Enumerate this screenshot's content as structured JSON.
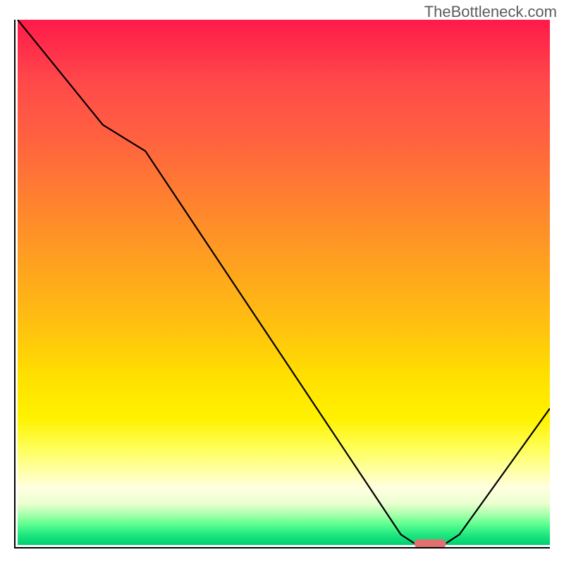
{
  "watermark": "TheBottleneck.com",
  "chart_data": {
    "type": "line",
    "title": "",
    "xlabel": "",
    "ylabel": "",
    "x_range": [
      0,
      100
    ],
    "y_range": [
      0,
      100
    ],
    "series": [
      {
        "name": "curve",
        "x": [
          0,
          16,
          24,
          72,
          75,
          80,
          83,
          100
        ],
        "values": [
          100,
          80,
          75,
          2,
          0,
          0,
          2,
          26
        ]
      }
    ],
    "marker": {
      "x": 77.5,
      "y": 0,
      "width": 6,
      "height": 2,
      "color": "#e27070"
    },
    "gradient_stops": [
      {
        "pos": 0.0,
        "color": "#ff1a4a"
      },
      {
        "pos": 0.12,
        "color": "#ff4a4a"
      },
      {
        "pos": 0.34,
        "color": "#ff8030"
      },
      {
        "pos": 0.58,
        "color": "#ffc010"
      },
      {
        "pos": 0.76,
        "color": "#fff200"
      },
      {
        "pos": 0.89,
        "color": "#ffffe0"
      },
      {
        "pos": 0.96,
        "color": "#60ff90"
      },
      {
        "pos": 1.0,
        "color": "#00d070"
      }
    ]
  }
}
